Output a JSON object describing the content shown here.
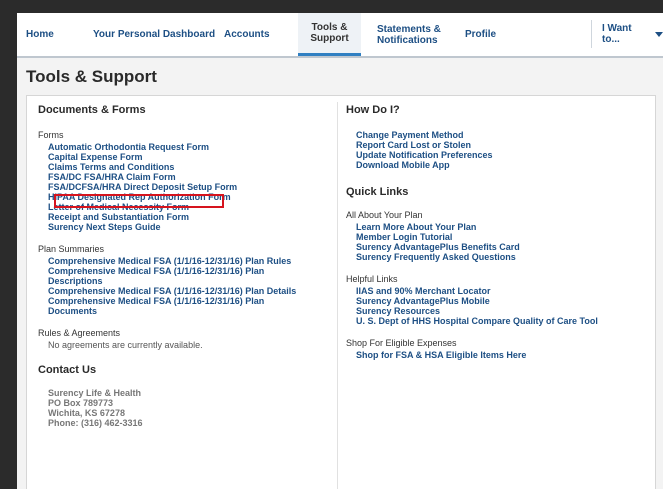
{
  "nav": {
    "home": "Home",
    "dashboard": "Your Personal Dashboard",
    "accounts": "Accounts",
    "tools_line1": "Tools &",
    "tools_line2": "Support",
    "statements_line1": "Statements &",
    "statements_line2": "Notifications",
    "profile": "Profile",
    "want_to": "I Want to..."
  },
  "page_title": "Tools & Support",
  "documents": {
    "title": "Documents & Forms",
    "forms_title": "Forms",
    "forms": [
      "Automatic Orthodontia Request Form",
      "Capital Expense Form",
      "Claims Terms and Conditions",
      "FSA/DC FSA/HRA Claim Form",
      "FSA/DCFSA/HRA Direct Deposit Setup Form",
      "HIPAA Designated Rep Authorization Form",
      "Letter of Medical Necessity Form",
      "Receipt and Substantiation Form",
      "Surency Next Steps Guide"
    ],
    "plan_title": "Plan Summaries",
    "plans": [
      "Comprehensive Medical FSA (1/1/16-12/31/16) Plan Rules",
      "Comprehensive Medical FSA (1/1/16-12/31/16) Plan Descriptions",
      "Comprehensive Medical FSA (1/1/16-12/31/16) Plan Details",
      "Comprehensive Medical FSA (1/1/16-12/31/16) Plan Documents"
    ],
    "rules_title": "Rules & Agreements",
    "rules_empty": "No agreements are currently available."
  },
  "contact": {
    "title": "Contact Us",
    "name": "Surency Life & Health",
    "box": "PO Box 789773",
    "city": "Wichita, KS 67278",
    "phone": "Phone: (316) 462-3316"
  },
  "howdoi": {
    "title": "How Do I?",
    "items": [
      "Change Payment Method",
      "Report Card Lost or Stolen",
      "Update Notification Preferences",
      "Download Mobile App"
    ]
  },
  "quick": {
    "title": "Quick Links",
    "plan_title": "All About Your Plan",
    "plan_items": [
      "Learn More About Your Plan",
      "Member Login Tutorial",
      "Surency AdvantagePlus Benefits Card",
      "Surency Frequently Asked Questions"
    ],
    "helpful_title": "Helpful Links",
    "helpful_items": [
      "IIAS and 90% Merchant Locator",
      "Surency AdvantagePlus Mobile",
      "Surency Resources",
      "U. S. Dept of HHS Hospital Compare Quality of Care Tool"
    ],
    "shop_title": "Shop For Eligible Expenses",
    "shop_items": [
      "Shop for FSA & HSA Eligible Items Here"
    ]
  }
}
